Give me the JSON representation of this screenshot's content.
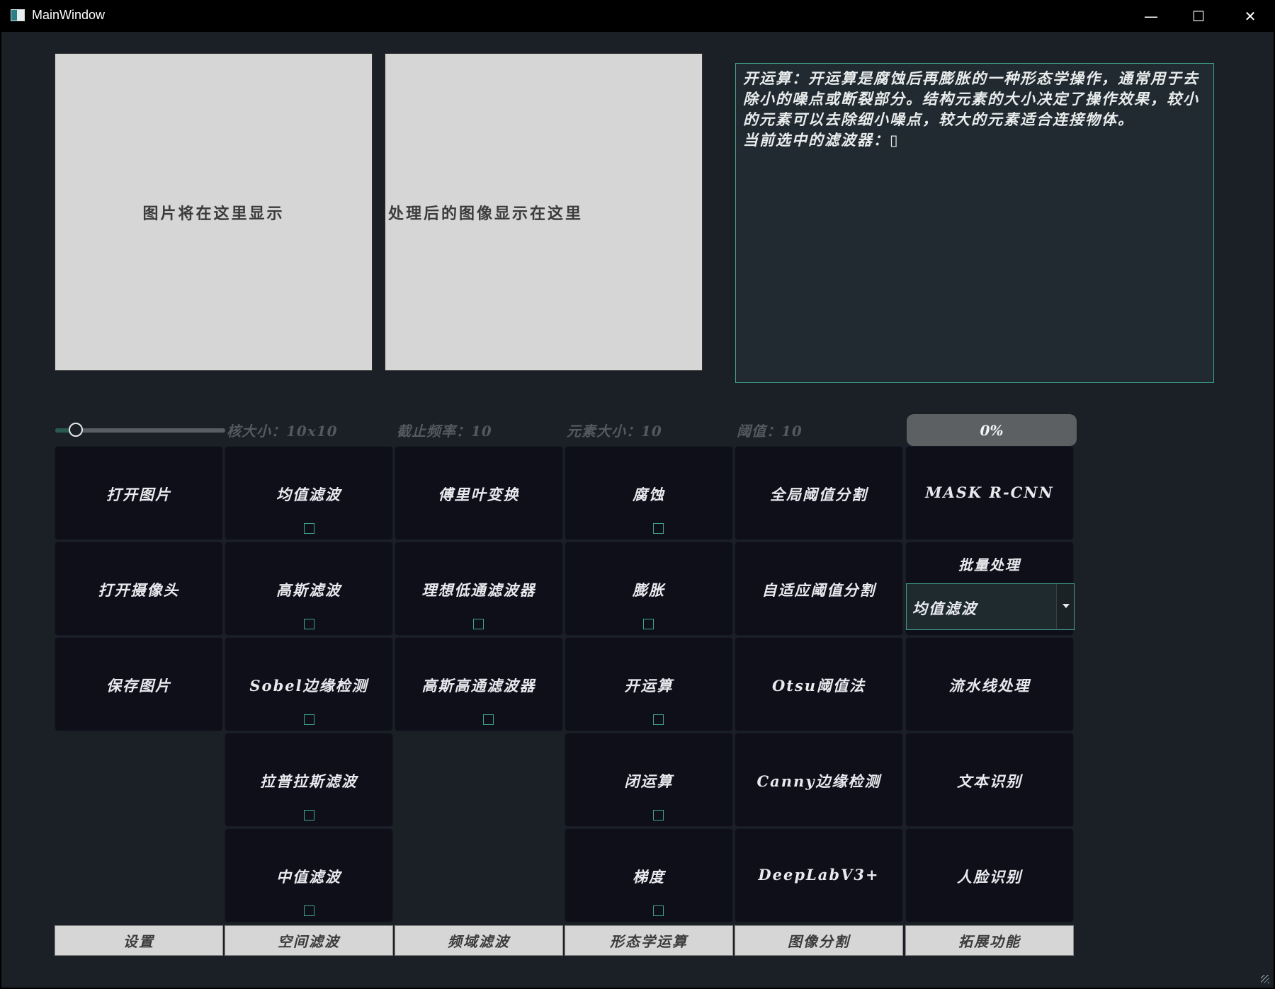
{
  "window": {
    "title": "MainWindow",
    "minimize_glyph": "—",
    "maximize_glyph": "☐",
    "close_glyph": "✕"
  },
  "image_panels": {
    "original_placeholder": "图片将在这里显示",
    "processed_placeholder": "处理后的图像显示在这里"
  },
  "info": {
    "description": "开运算：开运算是腐蚀后再膨胀的一种形态学操作，通常用于去除小的噪点或断裂部分。结构元素的大小决定了操作效果，较小的元素可以去除细小噪点，较大的元素适合连接物体。",
    "current_filter": "当前选中的滤波器：▯"
  },
  "slider": {
    "value_fraction": 0.12
  },
  "params": {
    "kernel_size": "核大小：10x10",
    "cutoff_freq": "截止频率：10",
    "element_size": "元素大小：10",
    "threshold": "阈值：10"
  },
  "progress": {
    "text": "0%",
    "value_percent": 0
  },
  "buttons": {
    "open_image": "打开图片",
    "open_camera": "打开摄像头",
    "save_image": "保存图片",
    "mean_filter": "均值滤波",
    "gaussian_filter": "高斯滤波",
    "sobel_edge": "Sobel边缘检测",
    "laplacian_filter": "拉普拉斯滤波",
    "median_filter": "中值滤波",
    "fourier_transform": "傅里叶变换",
    "ideal_lowpass": "理想低通滤波器",
    "gaussian_highpass": "高斯高通滤波器",
    "erosion": "腐蚀",
    "dilation": "膨胀",
    "opening": "开运算",
    "closing": "闭运算",
    "gradient": "梯度",
    "global_threshold": "全局阈值分割",
    "adaptive_threshold": "自适应阈值分割",
    "otsu": "Otsu阈值法",
    "canny": "Canny边缘检测",
    "deeplab": "DeepLabV3+",
    "mask_rcnn": "MASK R-CNN",
    "batch_label": "批量处理",
    "pipeline": "流水线处理",
    "text_recognition": "文本识别",
    "face_recognition": "人脸识别"
  },
  "batch_combo": {
    "selected": "均值滤波"
  },
  "tabs": [
    "设置",
    "空间滤波",
    "频域滤波",
    "形态学运算",
    "图像分割",
    "拓展功能"
  ],
  "colors": {
    "accent": "#3fa38f",
    "background": "#1a2025",
    "button_bg": "#0e0f19",
    "panel_bg": "#d6d6d6"
  }
}
